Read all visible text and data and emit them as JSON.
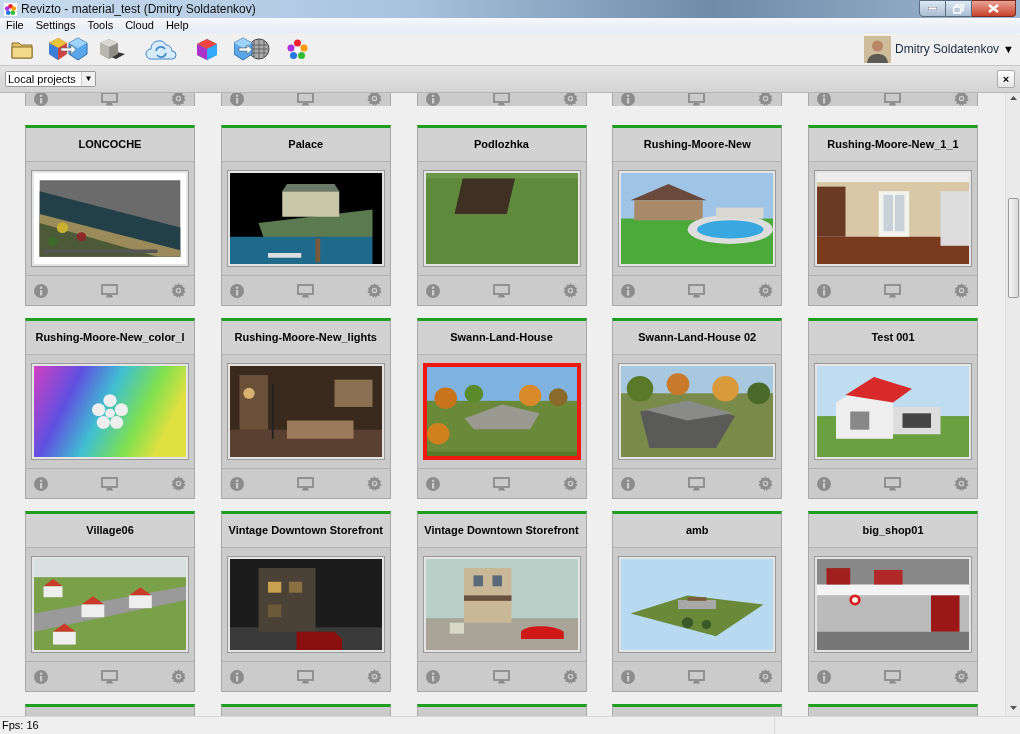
{
  "window": {
    "title": "Revizto - material_test (Dmitry Soldatenkov)"
  },
  "menu": [
    "File",
    "Settings",
    "Tools",
    "Cloud",
    "Help"
  ],
  "user": {
    "name": "Dmitry Soldatenkov",
    "caret": "▼"
  },
  "project_filter": {
    "value": "Local projects",
    "caret": "▼"
  },
  "close_panel": "×",
  "projects": [
    {
      "title": "LONCOCHE",
      "selected": false
    },
    {
      "title": "Palace",
      "selected": false
    },
    {
      "title": "Podlozhka",
      "selected": false
    },
    {
      "title": "Rushing-Moore-New",
      "selected": false
    },
    {
      "title": "Rushing-Moore-New_1_1",
      "selected": false
    },
    {
      "title": "Rushing-Moore-New_color_l",
      "selected": false
    },
    {
      "title": "Rushing-Moore-New_lights",
      "selected": false
    },
    {
      "title": "Swann-Land-House",
      "selected": true
    },
    {
      "title": "Swann-Land-House 02",
      "selected": false
    },
    {
      "title": "Test 001",
      "selected": false
    },
    {
      "title": "Village06",
      "selected": false
    },
    {
      "title": "Vintage Downtown Storefront",
      "selected": false
    },
    {
      "title": "Vintage Downtown Storefront",
      "selected": false
    },
    {
      "title": "amb",
      "selected": false
    },
    {
      "title": "big_shop01",
      "selected": false
    }
  ],
  "status_bar": {
    "fps": "Fps: 16"
  }
}
